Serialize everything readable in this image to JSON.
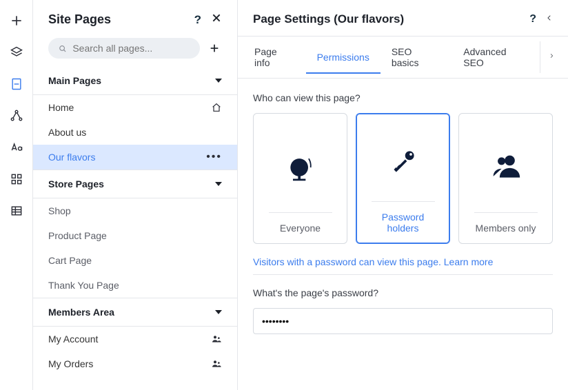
{
  "sidebar_rail": {
    "icons": [
      "plus",
      "layers",
      "page",
      "connections",
      "typography",
      "apps",
      "data"
    ]
  },
  "pages": {
    "title": "Site Pages",
    "search_placeholder": "Search all pages...",
    "sections": {
      "main": {
        "label": "Main Pages",
        "items": [
          {
            "label": "Home",
            "icon": "home"
          },
          {
            "label": "About us"
          },
          {
            "label": "Our flavors",
            "selected": true,
            "icon": "kebab"
          }
        ]
      },
      "store": {
        "label": "Store Pages",
        "items": [
          {
            "label": "Shop"
          },
          {
            "label": "Product Page"
          },
          {
            "label": "Cart Page"
          },
          {
            "label": "Thank You Page"
          }
        ]
      },
      "members": {
        "label": "Members Area",
        "items": [
          {
            "label": "My Account",
            "icon": "members"
          },
          {
            "label": "My Orders",
            "icon": "members"
          }
        ]
      }
    }
  },
  "settings": {
    "title": "Page Settings (Our flavors)",
    "tabs": {
      "info": "Page info",
      "permissions": "Permissions",
      "seo": "SEO basics",
      "advseo": "Advanced SEO"
    },
    "question": "Who can view this page?",
    "options": {
      "everyone": "Everyone",
      "password": "Password holders",
      "members": "Members only"
    },
    "desc_text": "Visitors with a password can view this page. ",
    "learn_more": "Learn more",
    "pw_question": "What's the page's password?",
    "pw_value": "••••••••"
  }
}
